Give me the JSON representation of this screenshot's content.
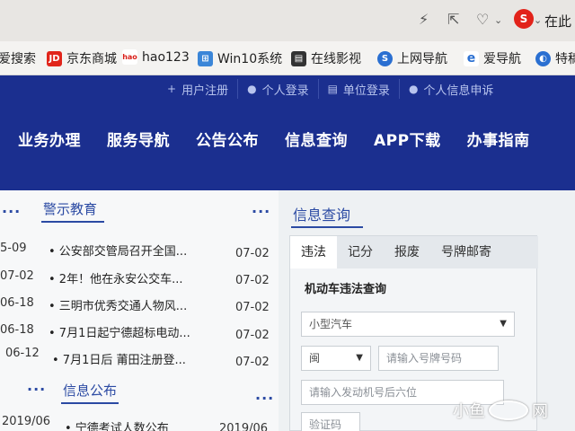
{
  "browser": {
    "toolbar_right_text": "在此",
    "sogou_label": "S"
  },
  "bookmarks": [
    {
      "label": "爱搜索",
      "icon": "none"
    },
    {
      "label": "京东商城",
      "icon": "jd-icon",
      "icon_text": "JD",
      "color": "#e1251b"
    },
    {
      "label": "hao123",
      "icon": "hao123-icon",
      "icon_text": "hao",
      "color": "#d91e18"
    },
    {
      "label": "Win10系统",
      "icon": "windows-icon",
      "icon_text": "⊞",
      "color": "#3b86d8"
    },
    {
      "label": "在线影视",
      "icon": "film-icon",
      "icon_text": "▤",
      "color": "#333333"
    },
    {
      "label": "上网导航",
      "icon": "nav-icon",
      "icon_text": "S",
      "color": "#2a6fd1"
    },
    {
      "label": "爱导航",
      "icon": "ie-icon",
      "icon_text": "e",
      "color": "#2a6fd1"
    },
    {
      "label": "特稿",
      "icon": "globe-icon",
      "icon_text": "◐",
      "color": "#2a6fd1"
    }
  ],
  "subnav": [
    {
      "label": "用户注册",
      "icon": "plus-icon",
      "glyph": "+"
    },
    {
      "label": "个人登录",
      "icon": "user-icon",
      "glyph": "●"
    },
    {
      "label": "单位登录",
      "icon": "doc-icon",
      "glyph": "▤"
    },
    {
      "label": "个人信息申诉",
      "icon": "user-icon",
      "glyph": "●"
    }
  ],
  "mainnav": [
    "业务办理",
    "服务导航",
    "公告公布",
    "信息查询",
    "APP下载",
    "办事指南"
  ],
  "warning": {
    "title": "警示教育",
    "more": "···",
    "items": [
      {
        "left_date": "5-09",
        "text": "• 公安部交管局召开全国...",
        "date": "07-02"
      },
      {
        "left_date": "07-02",
        "text": "• 2年！他在永安公交车...",
        "date": "07-02"
      },
      {
        "left_date": "06-18",
        "text": "• 三明市优秀交通人物风...",
        "date": "07-02"
      },
      {
        "left_date": "06-18",
        "text": "• 7月1日起宁德超标电动...",
        "date": "07-02"
      },
      {
        "left_date": "06-12",
        "text": "• 7月1日后 莆田注册登...",
        "date": "07-02"
      }
    ]
  },
  "info_pub": {
    "title": "信息公布",
    "more": "···",
    "left_more": "···",
    "left_date": "2019/06",
    "text": "• 宁德考试人数公布",
    "date": "2019/06"
  },
  "query": {
    "title": "信息查询",
    "tabs": [
      "违法",
      "记分",
      "报废",
      "号牌邮寄"
    ],
    "form_label": "机动车违法查询",
    "vehicle_type": "小型汽车",
    "province": "闽",
    "plate_placeholder": "请输入号牌号码",
    "engine_placeholder": "请输入发动机号后六位",
    "captcha_placeholder": "验证码"
  },
  "watermark": {
    "left": "小鱼",
    "right": "网"
  },
  "colors": {
    "header": "#1b2f8f",
    "accent": "#2b4aa3"
  }
}
